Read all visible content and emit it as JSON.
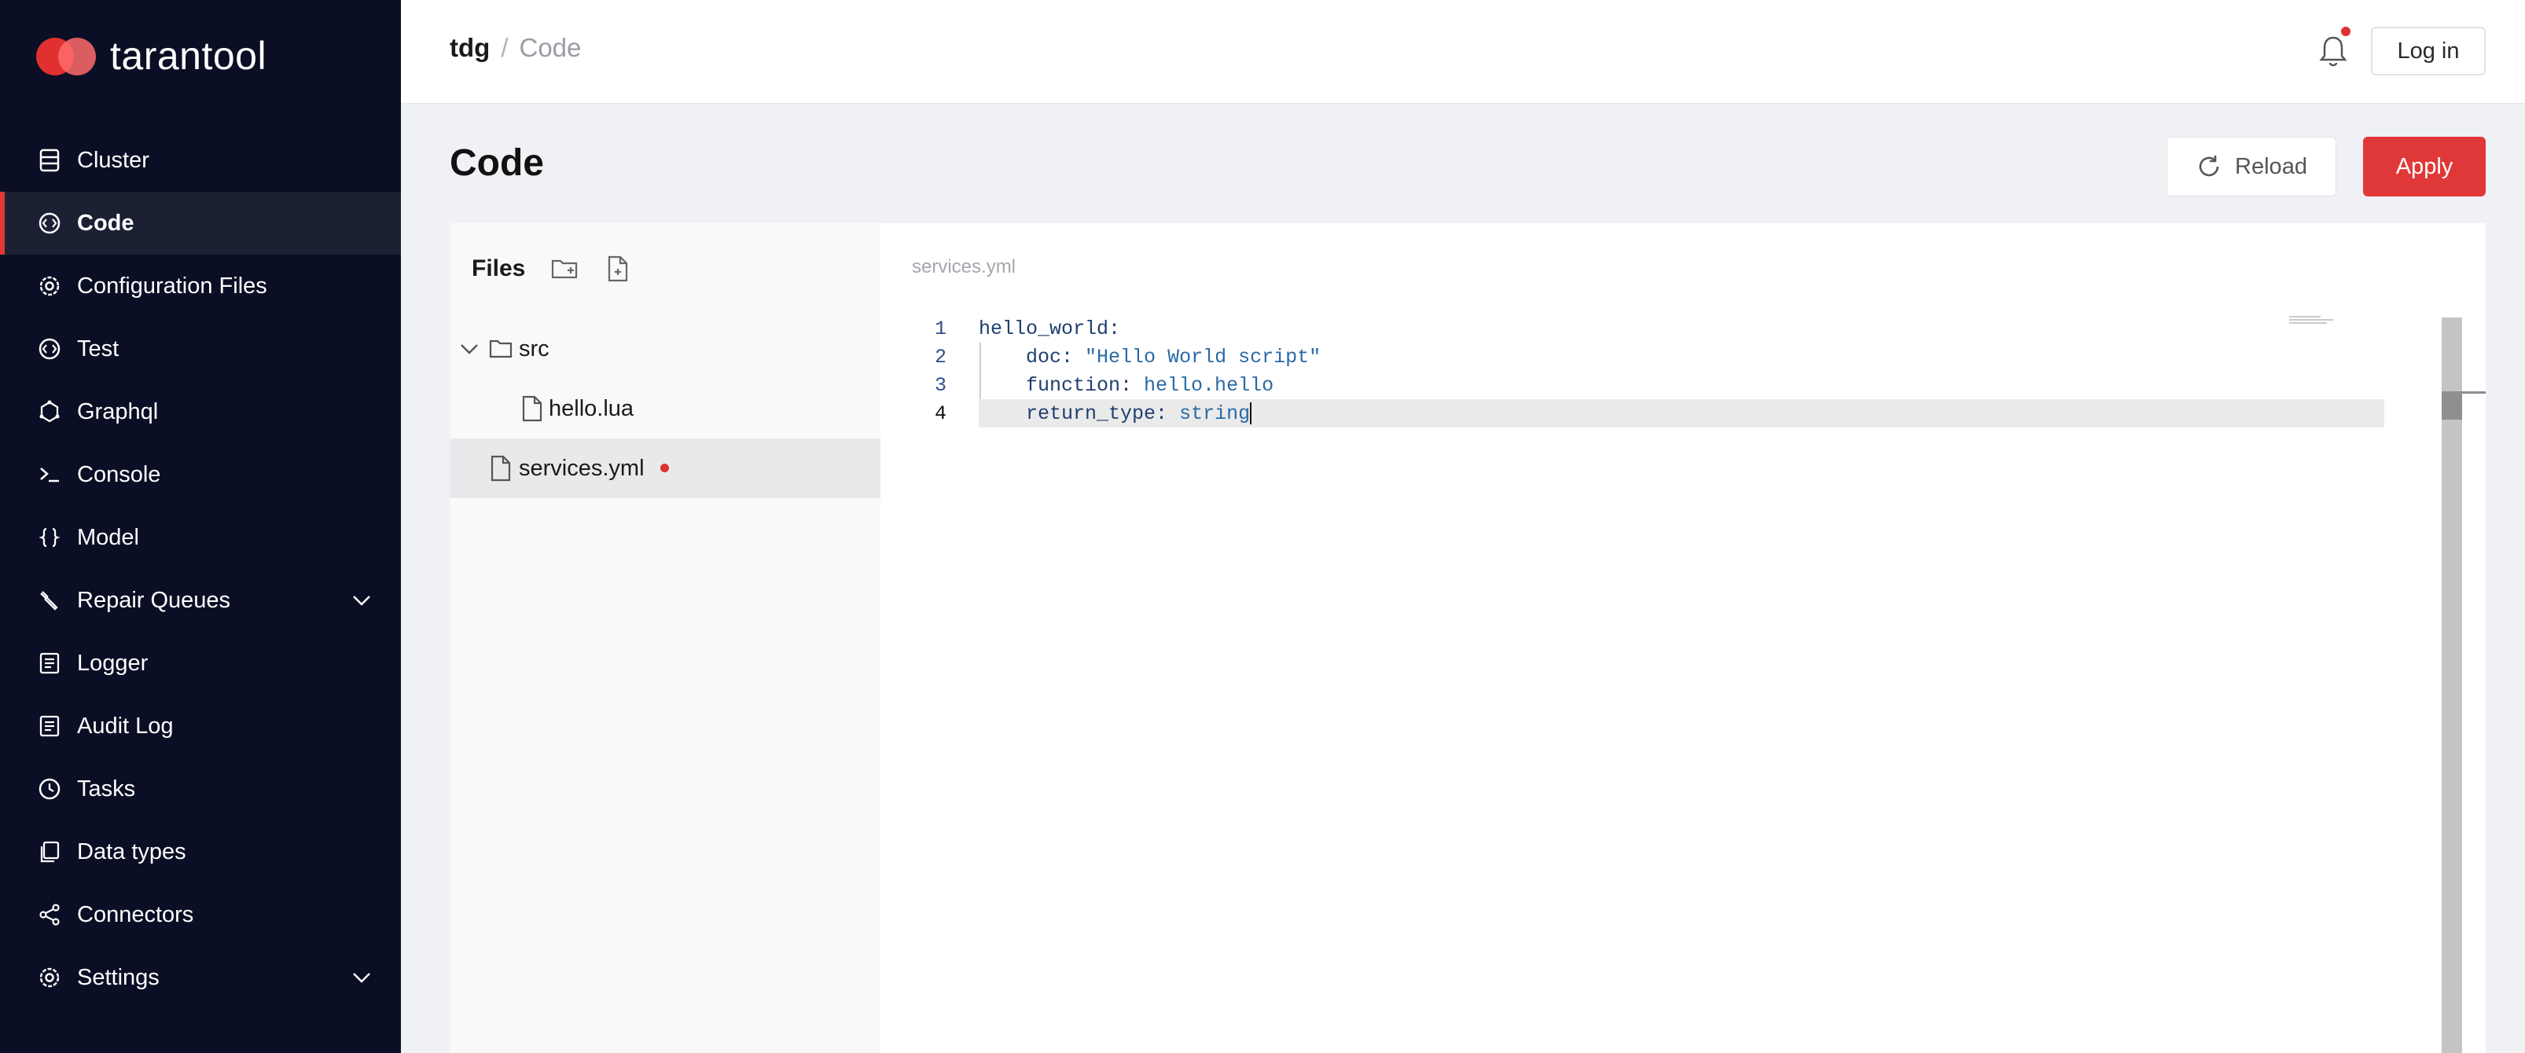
{
  "brand": {
    "name": "tarantool"
  },
  "nav": {
    "items": [
      {
        "label": "Cluster",
        "icon": "server-icon",
        "active": false,
        "expandable": false
      },
      {
        "label": "Code",
        "icon": "code-icon",
        "active": true,
        "expandable": false
      },
      {
        "label": "Configuration Files",
        "icon": "gear-icon",
        "active": false,
        "expandable": false
      },
      {
        "label": "Test",
        "icon": "code-icon",
        "active": false,
        "expandable": false
      },
      {
        "label": "Graphql",
        "icon": "graphql-icon",
        "active": false,
        "expandable": false
      },
      {
        "label": "Console",
        "icon": "terminal-icon",
        "active": false,
        "expandable": false
      },
      {
        "label": "Model",
        "icon": "braces-icon",
        "active": false,
        "expandable": false
      },
      {
        "label": "Repair Queues",
        "icon": "wrench-icon",
        "active": false,
        "expandable": true
      },
      {
        "label": "Logger",
        "icon": "document-icon",
        "active": false,
        "expandable": false
      },
      {
        "label": "Audit Log",
        "icon": "document-icon",
        "active": false,
        "expandable": false
      },
      {
        "label": "Tasks",
        "icon": "clock-icon",
        "active": false,
        "expandable": false
      },
      {
        "label": "Data types",
        "icon": "files-icon",
        "active": false,
        "expandable": false
      },
      {
        "label": "Connectors",
        "icon": "share-icon",
        "active": false,
        "expandable": false
      },
      {
        "label": "Settings",
        "icon": "gear-icon",
        "active": false,
        "expandable": true
      }
    ]
  },
  "header": {
    "breadcrumb_root": "tdg",
    "breadcrumb_sep": "/",
    "breadcrumb_current": "Code",
    "login_label": "Log in"
  },
  "page": {
    "title": "Code",
    "reload_label": "Reload",
    "apply_label": "Apply"
  },
  "files": {
    "title": "Files",
    "tree": [
      {
        "name": "src",
        "type": "folder",
        "expanded": true,
        "depth": 0
      },
      {
        "name": "hello.lua",
        "type": "file",
        "depth": 1
      },
      {
        "name": "services.yml",
        "type": "file",
        "depth": 0,
        "selected": true,
        "dirty": true
      }
    ]
  },
  "editor": {
    "filename": "services.yml",
    "lines": [
      {
        "num": "1",
        "key": "hello_world",
        "sep": ":",
        "value": ""
      },
      {
        "num": "2",
        "key": "    doc",
        "sep": ": ",
        "value": "\"Hello World script\""
      },
      {
        "num": "3",
        "key": "    function",
        "sep": ": ",
        "value": "hello.hello"
      },
      {
        "num": "4",
        "key": "    return_type",
        "sep": ": ",
        "value": "string"
      }
    ],
    "current_line": 4
  },
  "colors": {
    "sidebar_bg": "#0b0f25",
    "accent": "#e03838",
    "page_bg": "#f0f1f5"
  }
}
